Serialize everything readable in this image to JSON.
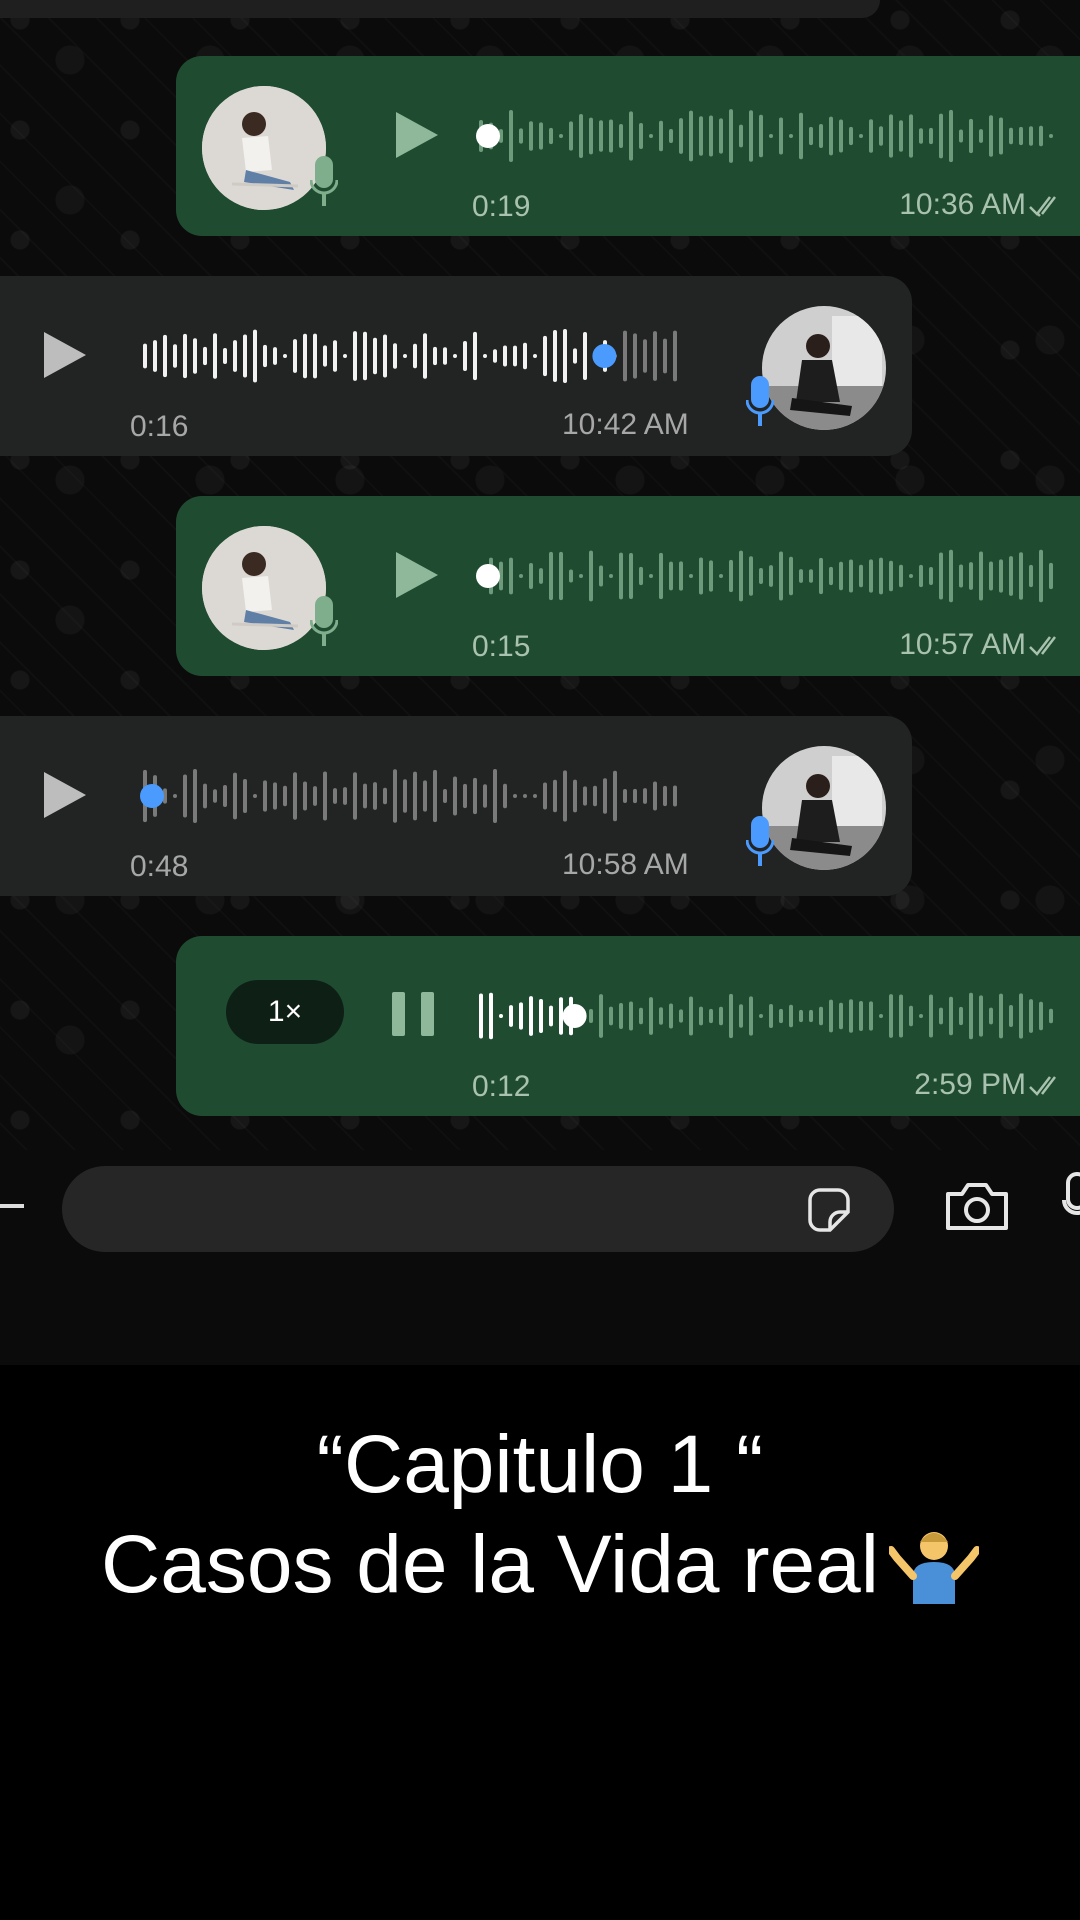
{
  "messages": [
    {
      "direction": "out",
      "duration": "0:19",
      "time": "10:36 AM",
      "status_icon": "double-check-icon",
      "control_icon": "play-icon",
      "progress": 0
    },
    {
      "direction": "in",
      "duration": "0:16",
      "time": "10:42 AM",
      "control_icon": "play-icon",
      "progress": 0.86
    },
    {
      "direction": "out",
      "duration": "0:15",
      "time": "10:57 AM",
      "status_icon": "double-check-icon",
      "control_icon": "play-icon",
      "progress": 0
    },
    {
      "direction": "in",
      "duration": "0:48",
      "time": "10:58 AM",
      "control_icon": "play-icon",
      "progress": 0
    },
    {
      "direction": "out",
      "duration": "0:12",
      "time": "2:59 PM",
      "status_icon": "double-check-icon",
      "control_icon": "pause-icon",
      "progress": 0.17,
      "speed": "1×"
    }
  ],
  "input_bar": {
    "icons": [
      "plus-icon",
      "sticker-icon",
      "camera-icon",
      "mic-icon"
    ]
  },
  "caption": {
    "line1": "“Capitulo 1 “",
    "line2": "Casos de la Vida real",
    "emoji": "🤷‍♂️"
  },
  "colors": {
    "outgoing_bubble": "#1f4c30",
    "incoming_bubble": "#222323",
    "played_accent": "#4b9bff",
    "mic_blue": "#4b9bff",
    "mic_green": "#7fae8c"
  }
}
